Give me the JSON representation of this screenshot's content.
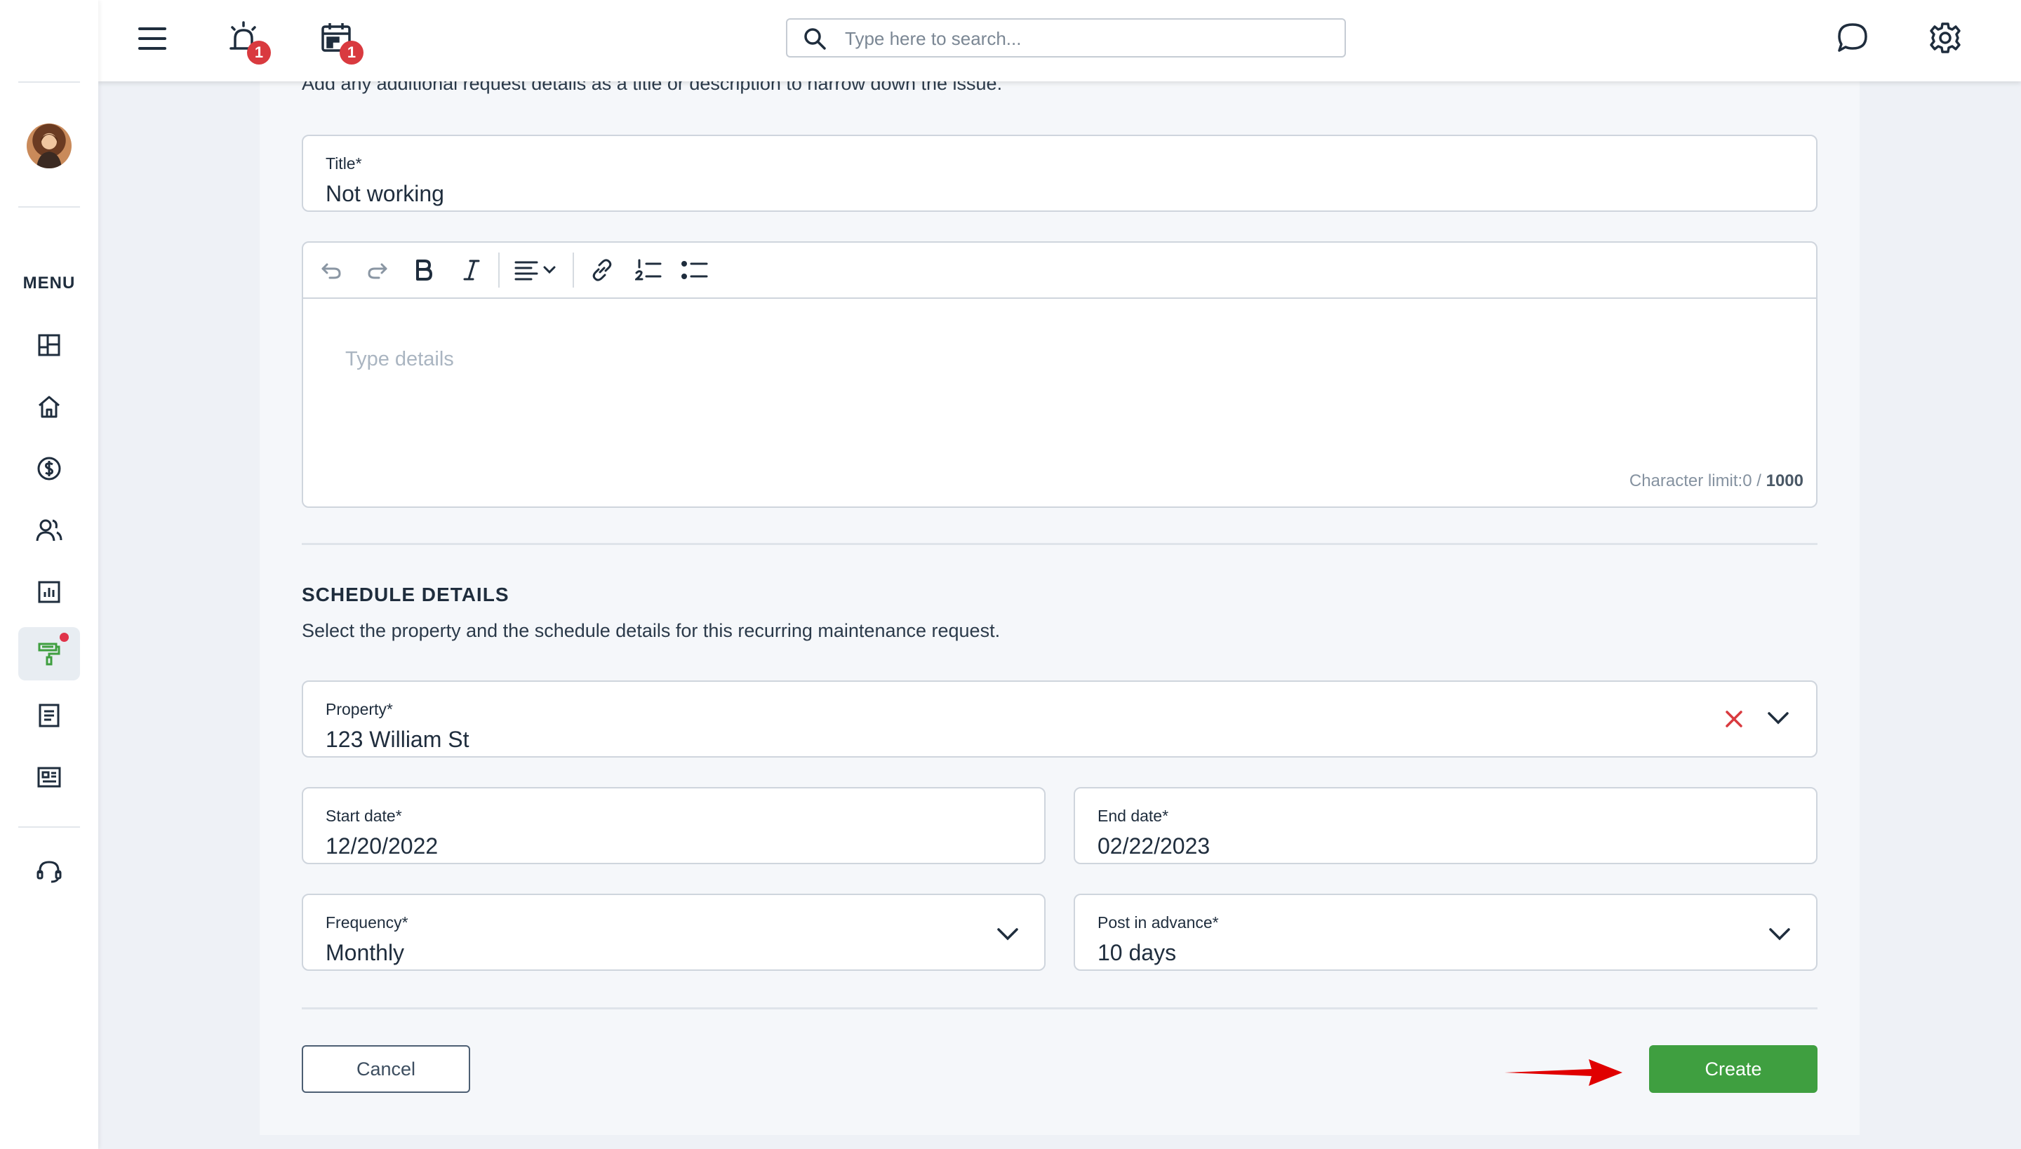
{
  "topbar": {
    "notification_badge": "1",
    "calendar_badge": "1",
    "search_placeholder": "Type here to search..."
  },
  "sidebar": {
    "menu_label": "MENU",
    "items": [
      {
        "icon": "dashboard-icon"
      },
      {
        "icon": "home-icon"
      },
      {
        "icon": "dollar-icon"
      },
      {
        "icon": "people-icon"
      },
      {
        "icon": "reports-icon"
      },
      {
        "icon": "maintenance-icon",
        "active": true,
        "has_dot": true
      },
      {
        "icon": "document-icon"
      },
      {
        "icon": "listing-icon"
      }
    ],
    "support_icon": "headset-icon"
  },
  "request": {
    "intro_text": "Add any additional request details as a title or description to narrow down the issue.",
    "title_label": "Title*",
    "title_value": "Not working",
    "details_placeholder": "Type details",
    "char_limit_label": "Character limit:",
    "char_count": "0",
    "char_separator": " / ",
    "char_max": "1000"
  },
  "schedule": {
    "section_title": "SCHEDULE DETAILS",
    "section_desc": "Select the property and the schedule details for this recurring maintenance request.",
    "property_label": "Property*",
    "property_value": "123 William St",
    "start_label": "Start date*",
    "start_value": "12/20/2022",
    "end_label": "End date*",
    "end_value": "02/22/2023",
    "frequency_label": "Frequency*",
    "frequency_value": "Monthly",
    "advance_label": "Post in advance*",
    "advance_value": "10 days"
  },
  "actions": {
    "cancel_label": "Cancel",
    "create_label": "Create"
  },
  "colors": {
    "primary_green": "#3f9f40",
    "badge_red": "#d93a3f",
    "annotation_arrow": "#e00000"
  }
}
